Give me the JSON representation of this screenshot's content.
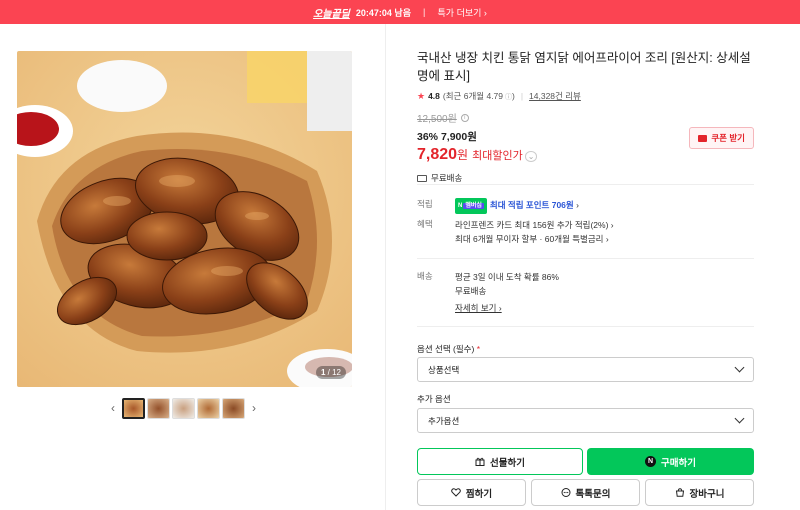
{
  "banner": {
    "brand": "오늘끝딜",
    "countdown": "20:47:04 남음",
    "more": "특가 더보기"
  },
  "gallery": {
    "current": "1",
    "total": "12"
  },
  "product": {
    "title": "국내산 냉장 치킨 통닭 염지닭 에어프라이어 조리 [원산지: 상세설명에 표시]",
    "rating": "4.8",
    "rating_detail": "(최근 6개월 4.79",
    "reviews": "14,328건 리뷰",
    "original_price": "12,500원",
    "discount": "36%",
    "sale_price": "7,900원",
    "max_price": "7,820",
    "max_price_unit": "원",
    "max_label": "최대할인가",
    "coupon": "쿠폰 받기",
    "shipping": "무료배송"
  },
  "details": {
    "points_label": "적립",
    "npay_badge": "N",
    "npay_sub": "멤버십",
    "points_value": "최대 적립 포인트 706원",
    "benefit_label": "혜택",
    "benefit_1": "라인프렌즈 카드 최대 156원 추가 적립(2%)",
    "benefit_2": "최대 6개월 무이자 할부 · 60개월 특별금리",
    "delivery_label": "배송",
    "delivery_1": "평균 3일 이내 도착 확률 86%",
    "delivery_2": "무료배송",
    "delivery_more": "자세히 보기"
  },
  "options": {
    "select_label": "옵션 선택 (필수)",
    "required_mark": "*",
    "select_value": "상품선택",
    "extra_label": "추가 옵션",
    "extra_value": "추가옵션"
  },
  "actions": {
    "gift": "선물하기",
    "buy": "구매하기",
    "buy_mark": "N",
    "wish": "찜하기",
    "talk": "톡톡문의",
    "cart": "장바구니"
  },
  "colors": {
    "banner": "#fb4452",
    "accent_red": "#e3242b",
    "npay_green": "#03c75a"
  }
}
